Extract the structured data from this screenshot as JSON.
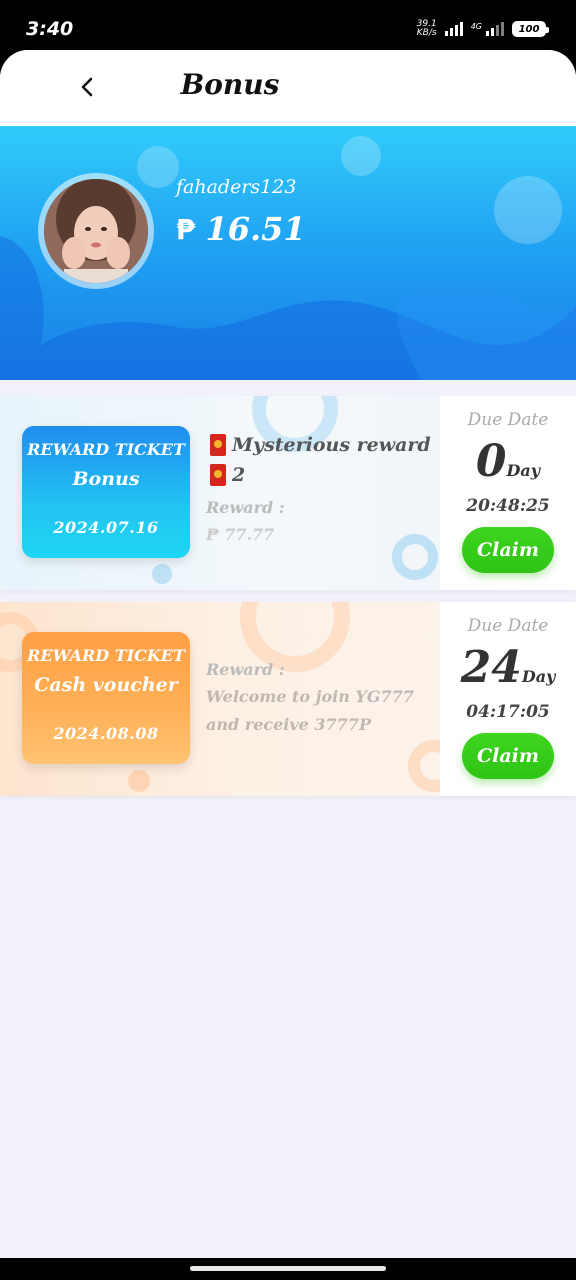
{
  "status_bar": {
    "time": "3:40",
    "net_speed_top": "39.1",
    "net_speed_bottom": "KB/s",
    "network_label": "4G",
    "battery": "100"
  },
  "header": {
    "back_icon": "chevron-left-icon",
    "title": "Bonus"
  },
  "profile": {
    "username": "fahaders123",
    "currency_symbol": "₱",
    "balance": "16.51",
    "colors": {
      "gradient_top": "#31cbfa",
      "gradient_bottom": "#1a7fe6"
    }
  },
  "tickets": [
    {
      "badge_title": "REWARD TICKET",
      "badge_subtitle": "Bonus",
      "badge_date": "2024.07.16",
      "badge_color": "#1f8df0",
      "items": [
        "Mysterious reward",
        "2"
      ],
      "reward_label": "Reward :",
      "reward_value": "₱ 77.77",
      "due_label": "Due Date",
      "due_days": "0",
      "due_unit": "Day",
      "due_time": "20:48:25",
      "claim_label": "Claim"
    },
    {
      "badge_title": "REWARD TICKET",
      "badge_subtitle": "Cash voucher",
      "badge_date": "2024.08.08",
      "badge_color": "#ff9f45",
      "reward_label": "Reward :",
      "reward_text_1": "Welcome to join YG777",
      "reward_text_2": "and receive 3777P",
      "due_label": "Due Date",
      "due_days": "24",
      "due_unit": "Day",
      "due_time": "04:17:05",
      "claim_label": "Claim"
    }
  ],
  "accent_colors": {
    "claim": "#2fc315"
  }
}
